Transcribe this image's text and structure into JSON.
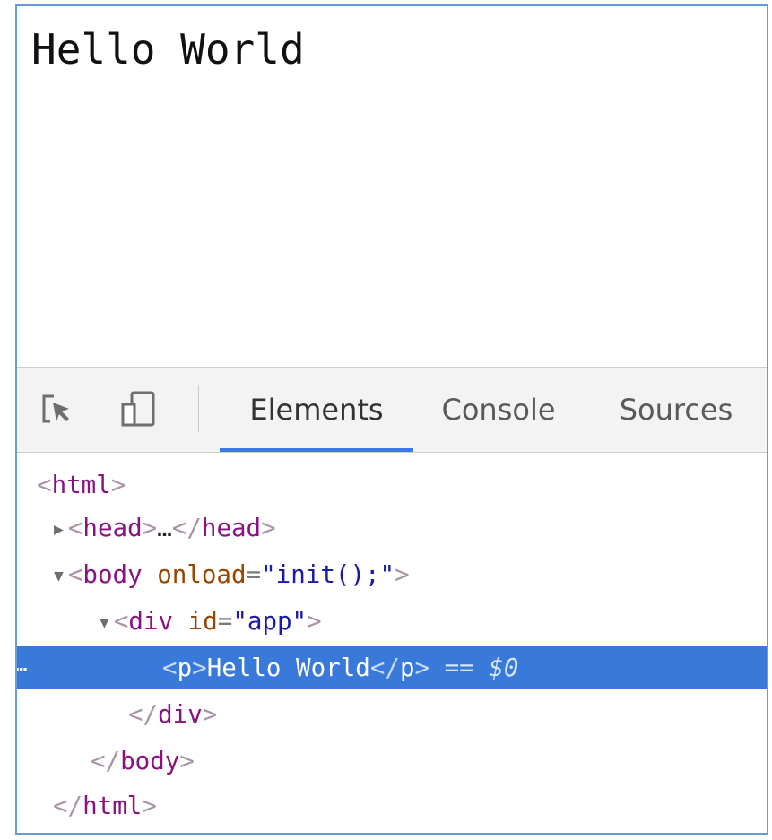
{
  "page": {
    "text": "Hello World"
  },
  "devtools": {
    "toolbar": {
      "inspect_icon": "inspect-element-icon",
      "device_icon": "device-toolbar-icon",
      "tabs": [
        {
          "label": "Elements",
          "active": true
        },
        {
          "label": "Console",
          "active": false
        },
        {
          "label": "Sources",
          "active": false
        }
      ]
    },
    "dom": {
      "html_open": "html",
      "head_tag": "head",
      "head_ellipsis": "…",
      "body_tag": "body",
      "body_attr_name": "onload",
      "body_attr_value": "\"init();\"",
      "div_tag": "div",
      "div_attr_name": "id",
      "div_attr_value": "\"app\"",
      "p_tag": "p",
      "p_text": "Hello World",
      "selected_marker": "== $0",
      "row_ellipsis": "…",
      "div_close": "div",
      "body_close": "body",
      "html_close": "html"
    },
    "colors": {
      "selection": "#3879d9",
      "active_tab_underline": "#3b78e7",
      "tag": "#881280",
      "attribute_name": "#994500",
      "attribute_value": "#1a1aa6"
    }
  }
}
